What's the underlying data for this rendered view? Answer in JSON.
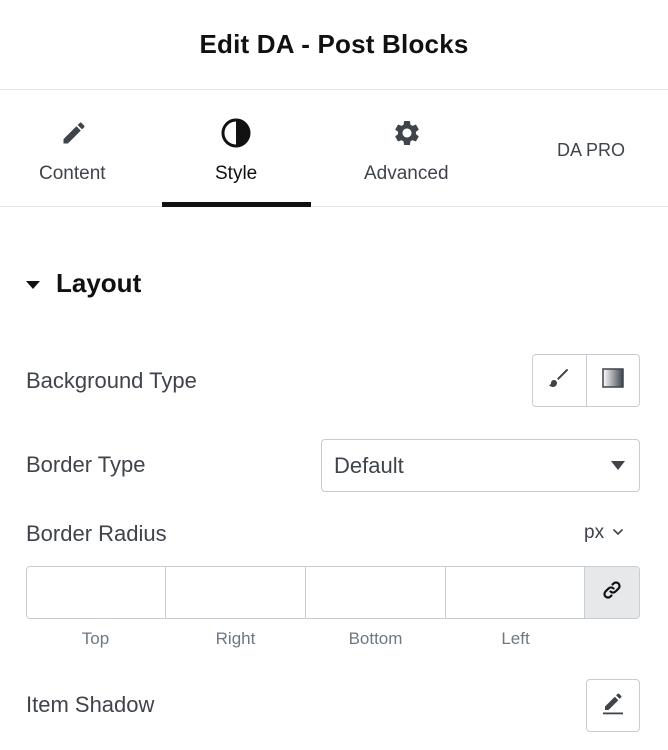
{
  "header": {
    "title": "Edit DA - Post Blocks"
  },
  "tabs": [
    {
      "label": "Content",
      "icon": "pencil-icon"
    },
    {
      "label": "Style",
      "icon": "half-circle-icon",
      "active": true
    },
    {
      "label": "Advanced",
      "icon": "gear-icon"
    },
    {
      "label": "DA PRO"
    }
  ],
  "section": {
    "title": "Layout"
  },
  "background_type": {
    "label": "Background Type",
    "options": [
      "brush-icon",
      "gradient-icon"
    ]
  },
  "border_type": {
    "label": "Border Type",
    "value": "Default"
  },
  "border_radius": {
    "label": "Border Radius",
    "unit": "px",
    "fields": [
      "Top",
      "Right",
      "Bottom",
      "Left"
    ]
  },
  "item_shadow": {
    "label": "Item Shadow"
  },
  "colors": {
    "text": "#3f444b",
    "border": "#c9cdd1",
    "active": "#111111",
    "muted": "#6d7882"
  }
}
